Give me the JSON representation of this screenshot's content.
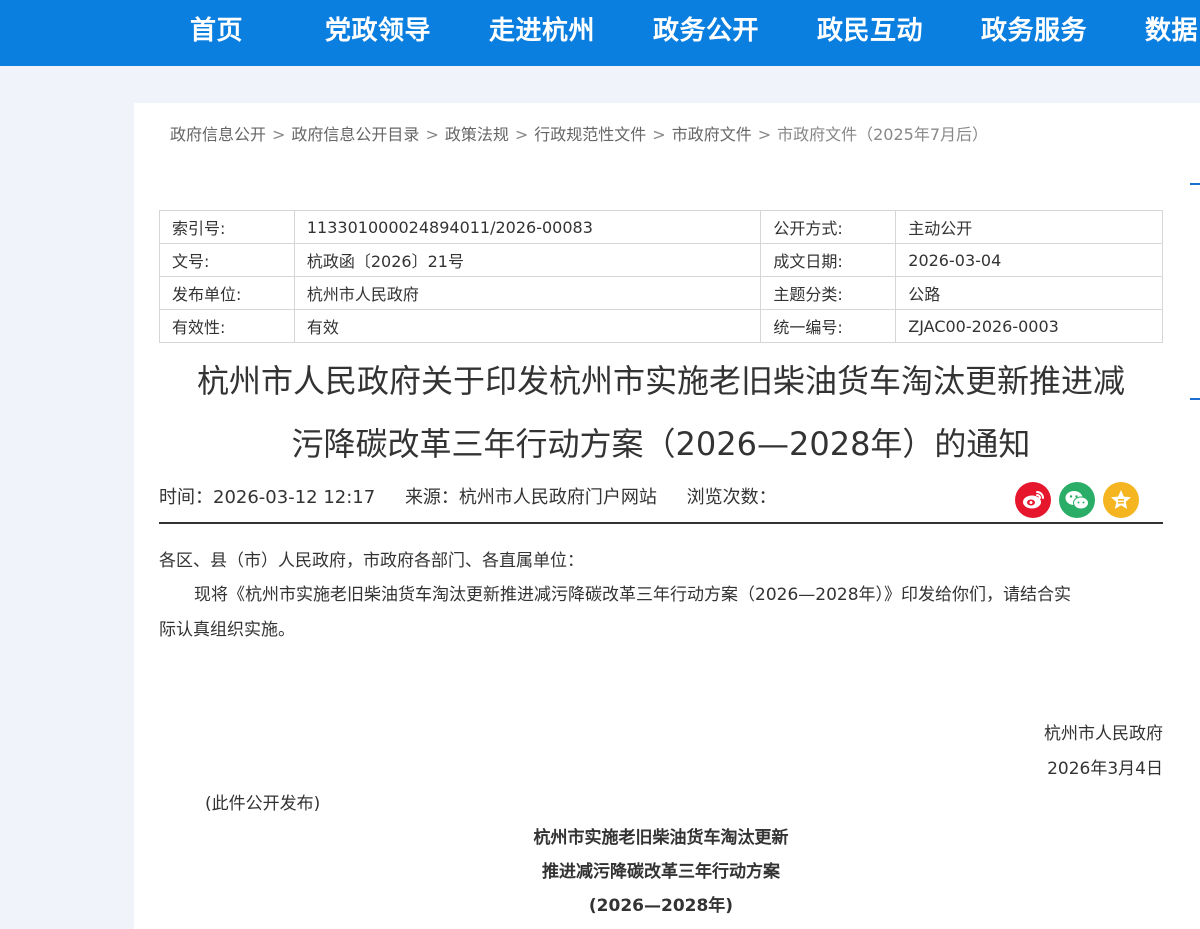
{
  "nav": [
    "首页",
    "党政领导",
    "走进杭州",
    "政务公开",
    "政民互动",
    "政务服务",
    "数据"
  ],
  "breadcrumb": [
    "政府信息公开",
    "政府信息公开目录",
    "政策法规",
    "行政规范性文件",
    "市政府文件",
    "市政府文件（2025年7月后）"
  ],
  "breadcrumb_sep": ">",
  "meta": {
    "index_label": "索引号:",
    "index_value": "113301000024894011/2026-00083",
    "open_label": "公开方式:",
    "open_value": "主动公开",
    "docno_label": "文号:",
    "docno_value": "杭政函〔2026〕21号",
    "date_label": "成文日期:",
    "date_value": "2026-03-04",
    "issuer_label": "发布单位:",
    "issuer_value": "杭州市人民政府",
    "topic_label": "主题分类:",
    "topic_value": "公路",
    "valid_label": "有效性:",
    "valid_value": "有效",
    "code_label": "统一编号:",
    "code_value": "ZJAC00-2026-0003"
  },
  "title_line1": "杭州市人民政府关于印发杭州市实施老旧柴油货车淘汰更新推进减",
  "title_line2": "污降碳改革三年行动方案（2026—2028年）的通知",
  "info": {
    "time": "时间：2026-03-12 12:17",
    "source": "来源：杭州市人民政府门户网站",
    "views": "浏览次数："
  },
  "share": [
    "weibo-icon",
    "wechat-icon",
    "favorite-icon"
  ],
  "body": {
    "salutation": "各区、县（市）人民政府，市政府各部门、各直属单位：",
    "para_line1": "现将《杭州市实施老旧柴油货车淘汰更新推进减污降碳改革三年行动方案（2026—2028年）》印发给你们，请结合实",
    "para_line2": "际认真组织实施。",
    "signature": "杭州市人民政府",
    "sign_date": "2026年3月4日",
    "public_note": "(此件公开发布)",
    "plan_title1": "杭州市实施老旧柴油货车淘汰更新",
    "plan_title2": "推进减污降碳改革三年行动方案",
    "plan_title3": "(2026—2028年)"
  },
  "colors": {
    "nav_bg": "#0b7fe0",
    "page_bg": "#f0f4fa",
    "weibo": "#e6162d",
    "wechat": "#2aae67",
    "fav": "#f4b520"
  }
}
